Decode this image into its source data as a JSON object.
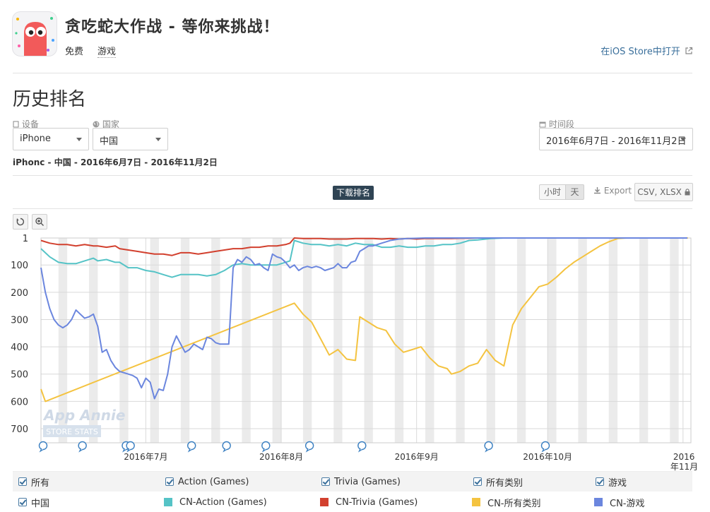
{
  "header": {
    "title": "贪吃蛇大作战 - 等你来挑战！",
    "price": "免费",
    "category": "游戏",
    "store_link": "在iOS Store中打开"
  },
  "section": {
    "title": "历史排名"
  },
  "filters": {
    "device_label": "设备",
    "device_value": "iPhone",
    "country_label": "国家",
    "country_value": "中国",
    "period_label": "时间段",
    "period_value": "2016年6月7日 - 2016年11月2日",
    "summary": "iPhonc - 中国 - 2016年6月7日 - 2016年11月2日"
  },
  "toolbar": {
    "chart_tag": "下载排名",
    "hour_label": "小时",
    "day_label": "天",
    "export_label": "Export",
    "csv_label": "CSV, XLSX"
  },
  "watermark": {
    "brand": "App Annie",
    "sub": "STORE STATS"
  },
  "legend": {
    "row1": [
      "所有",
      "Action (Games)",
      "Trivia (Games)",
      "所有类别",
      "游戏"
    ],
    "row2_country": "中国",
    "row2_series": [
      "CN-Action (Games)",
      "CN-Trivia (Games)",
      "CN-所有类别",
      "CN-游戏"
    ]
  },
  "colors": {
    "action": "#55c3c6",
    "trivia": "#d2402e",
    "all": "#f4c340",
    "games": "#6b86de",
    "link": "#3a6f9b"
  },
  "icons": [
    "app-icon",
    "external-link-icon",
    "device-icon",
    "globe-icon",
    "calendar-icon",
    "download-icon",
    "lock-icon",
    "reset-icon",
    "zoom-icon",
    "event-marker-icon",
    "checkbox-icon"
  ],
  "chart_data": {
    "type": "line",
    "title": "下载排名",
    "x_labels": [
      "2016年7月",
      "2016年8月",
      "2016年9月",
      "2016年10月",
      "2016年11月"
    ],
    "y_ticks": [
      1,
      100,
      200,
      300,
      400,
      500,
      600,
      700
    ],
    "y_inverted": true,
    "ylim": [
      1,
      750
    ],
    "x_range_day": [
      0,
      148
    ],
    "grid": true,
    "weekend_bands": true,
    "event_marker_days": [
      0,
      9,
      19,
      20,
      34,
      42,
      51,
      61,
      73,
      102,
      115
    ],
    "series": [
      {
        "name": "CN-Action (Games)",
        "color": "#55c3c6",
        "points": [
          [
            0,
            40
          ],
          [
            2,
            70
          ],
          [
            4,
            90
          ],
          [
            6,
            95
          ],
          [
            8,
            95
          ],
          [
            10,
            85
          ],
          [
            12,
            75
          ],
          [
            13,
            85
          ],
          [
            15,
            80
          ],
          [
            17,
            90
          ],
          [
            18,
            90
          ],
          [
            20,
            110
          ],
          [
            22,
            110
          ],
          [
            24,
            120
          ],
          [
            26,
            125
          ],
          [
            28,
            135
          ],
          [
            30,
            145
          ],
          [
            32,
            135
          ],
          [
            34,
            135
          ],
          [
            36,
            135
          ],
          [
            38,
            140
          ],
          [
            40,
            135
          ],
          [
            42,
            120
          ],
          [
            44,
            100
          ],
          [
            46,
            95
          ],
          [
            48,
            100
          ],
          [
            50,
            100
          ],
          [
            52,
            100
          ],
          [
            54,
            100
          ],
          [
            56,
            90
          ],
          [
            57,
            85
          ],
          [
            58,
            10
          ],
          [
            60,
            20
          ],
          [
            62,
            25
          ],
          [
            64,
            25
          ],
          [
            66,
            30
          ],
          [
            68,
            25
          ],
          [
            70,
            30
          ],
          [
            72,
            20
          ],
          [
            74,
            25
          ],
          [
            76,
            25
          ],
          [
            78,
            35
          ],
          [
            80,
            35
          ],
          [
            82,
            30
          ],
          [
            84,
            35
          ],
          [
            86,
            35
          ],
          [
            88,
            30
          ],
          [
            90,
            30
          ],
          [
            92,
            25
          ],
          [
            94,
            25
          ],
          [
            96,
            20
          ],
          [
            98,
            10
          ],
          [
            100,
            8
          ],
          [
            103,
            3
          ],
          [
            106,
            1
          ],
          [
            148,
            1
          ]
        ]
      },
      {
        "name": "CN-Trivia (Games)",
        "color": "#d2402e",
        "points": [
          [
            0,
            10
          ],
          [
            2,
            20
          ],
          [
            4,
            25
          ],
          [
            6,
            25
          ],
          [
            8,
            30
          ],
          [
            10,
            25
          ],
          [
            12,
            30
          ],
          [
            13,
            30
          ],
          [
            15,
            35
          ],
          [
            17,
            30
          ],
          [
            18,
            40
          ],
          [
            20,
            45
          ],
          [
            22,
            50
          ],
          [
            24,
            55
          ],
          [
            26,
            60
          ],
          [
            28,
            60
          ],
          [
            30,
            65
          ],
          [
            32,
            55
          ],
          [
            34,
            55
          ],
          [
            36,
            60
          ],
          [
            38,
            55
          ],
          [
            40,
            50
          ],
          [
            42,
            45
          ],
          [
            44,
            40
          ],
          [
            46,
            40
          ],
          [
            48,
            35
          ],
          [
            50,
            35
          ],
          [
            52,
            30
          ],
          [
            54,
            30
          ],
          [
            56,
            25
          ],
          [
            57,
            20
          ],
          [
            58,
            1
          ],
          [
            60,
            3
          ],
          [
            62,
            3
          ],
          [
            64,
            3
          ],
          [
            66,
            5
          ],
          [
            68,
            5
          ],
          [
            70,
            5
          ],
          [
            72,
            3
          ],
          [
            74,
            3
          ],
          [
            76,
            3
          ],
          [
            78,
            5
          ],
          [
            80,
            3
          ],
          [
            82,
            5
          ],
          [
            84,
            3
          ],
          [
            86,
            5
          ],
          [
            88,
            3
          ],
          [
            90,
            3
          ],
          [
            92,
            3
          ],
          [
            94,
            3
          ],
          [
            96,
            2
          ],
          [
            98,
            2
          ],
          [
            100,
            1
          ],
          [
            148,
            1
          ]
        ]
      },
      {
        "name": "CN-所有类别",
        "color": "#f4c340",
        "points": [
          [
            0,
            555
          ],
          [
            1,
            600
          ],
          [
            58,
            240
          ],
          [
            60,
            280
          ],
          [
            62,
            310
          ],
          [
            64,
            370
          ],
          [
            66,
            430
          ],
          [
            68,
            410
          ],
          [
            70,
            445
          ],
          [
            72,
            450
          ],
          [
            73,
            290
          ],
          [
            75,
            310
          ],
          [
            77,
            330
          ],
          [
            79,
            340
          ],
          [
            81,
            390
          ],
          [
            83,
            420
          ],
          [
            85,
            410
          ],
          [
            87,
            400
          ],
          [
            89,
            440
          ],
          [
            91,
            470
          ],
          [
            93,
            480
          ],
          [
            94,
            500
          ],
          [
            96,
            490
          ],
          [
            98,
            470
          ],
          [
            100,
            460
          ],
          [
            102,
            410
          ],
          [
            104,
            450
          ],
          [
            106,
            470
          ],
          [
            108,
            320
          ],
          [
            110,
            260
          ],
          [
            112,
            220
          ],
          [
            114,
            180
          ],
          [
            116,
            170
          ],
          [
            118,
            145
          ],
          [
            120,
            115
          ],
          [
            122,
            90
          ],
          [
            124,
            70
          ],
          [
            126,
            50
          ],
          [
            128,
            30
          ],
          [
            130,
            15
          ],
          [
            132,
            3
          ],
          [
            134,
            1
          ],
          [
            148,
            1
          ],
          [
            146,
            1
          ],
          [
            148,
            1
          ]
        ]
      },
      {
        "name": "CN-游戏",
        "color": "#6b86de",
        "points": [
          [
            0,
            110
          ],
          [
            1,
            200
          ],
          [
            2,
            260
          ],
          [
            3,
            300
          ],
          [
            4,
            320
          ],
          [
            5,
            330
          ],
          [
            6,
            320
          ],
          [
            7,
            300
          ],
          [
            8,
            265
          ],
          [
            9,
            280
          ],
          [
            10,
            295
          ],
          [
            11,
            290
          ],
          [
            12,
            280
          ],
          [
            13,
            325
          ],
          [
            14,
            420
          ],
          [
            15,
            410
          ],
          [
            16,
            450
          ],
          [
            17,
            475
          ],
          [
            18,
            490
          ],
          [
            19,
            495
          ],
          [
            20,
            500
          ],
          [
            21,
            505
          ],
          [
            22,
            515
          ],
          [
            23,
            550
          ],
          [
            24,
            515
          ],
          [
            25,
            530
          ],
          [
            26,
            590
          ],
          [
            27,
            555
          ],
          [
            28,
            560
          ],
          [
            29,
            500
          ],
          [
            30,
            400
          ],
          [
            31,
            360
          ],
          [
            32,
            390
          ],
          [
            33,
            420
          ],
          [
            34,
            410
          ],
          [
            35,
            390
          ],
          [
            36,
            400
          ],
          [
            37,
            410
          ],
          [
            38,
            365
          ],
          [
            39,
            370
          ],
          [
            40,
            385
          ],
          [
            41,
            390
          ],
          [
            42,
            390
          ],
          [
            43,
            390
          ],
          [
            44,
            110
          ],
          [
            45,
            80
          ],
          [
            46,
            90
          ],
          [
            47,
            70
          ],
          [
            48,
            80
          ],
          [
            49,
            100
          ],
          [
            50,
            95
          ],
          [
            51,
            110
          ],
          [
            52,
            120
          ],
          [
            53,
            60
          ],
          [
            54,
            70
          ],
          [
            55,
            75
          ],
          [
            56,
            90
          ],
          [
            57,
            110
          ],
          [
            58,
            100
          ],
          [
            59,
            120
          ],
          [
            60,
            110
          ],
          [
            61,
            105
          ],
          [
            62,
            110
          ],
          [
            63,
            105
          ],
          [
            64,
            110
          ],
          [
            65,
            120
          ],
          [
            66,
            115
          ],
          [
            67,
            110
          ],
          [
            68,
            95
          ],
          [
            69,
            110
          ],
          [
            70,
            110
          ],
          [
            71,
            90
          ],
          [
            72,
            85
          ],
          [
            73,
            50
          ],
          [
            74,
            40
          ],
          [
            75,
            30
          ],
          [
            76,
            30
          ],
          [
            77,
            25
          ],
          [
            78,
            20
          ],
          [
            79,
            15
          ],
          [
            80,
            10
          ],
          [
            82,
            5
          ],
          [
            84,
            3
          ],
          [
            86,
            2
          ],
          [
            88,
            1
          ],
          [
            148,
            1
          ]
        ]
      }
    ]
  }
}
